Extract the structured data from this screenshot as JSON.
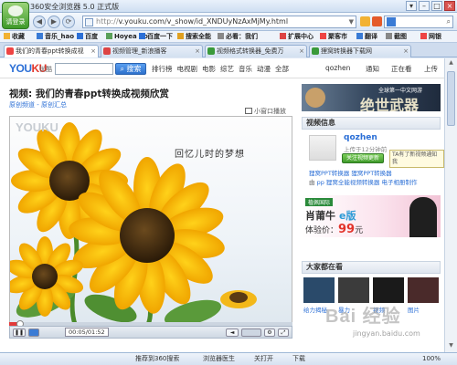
{
  "window": {
    "title": "360安全浏览器 5.0 正式版",
    "logo_label": "请登录",
    "controls": [
      "▾",
      "–",
      "□",
      "×"
    ]
  },
  "nav": {
    "url_prefix": "http://",
    "url": "v.youku.com/v_show/id_XNDUyNzAxMjMy.html",
    "search_placeholder": "",
    "buttons": [
      "◀",
      "▶",
      "⟳",
      "⌂"
    ]
  },
  "favorites": {
    "items": [
      "收藏",
      "音乐_hao",
      "百度",
      "Hoyea So",
      "百度一下",
      "搜索全能",
      "必看：我们",
      "扩展中心",
      "聚客市",
      "翻译",
      "截图",
      "网银"
    ]
  },
  "tabs": [
    {
      "label": "我们的青春ppt转换成视",
      "active": true
    },
    {
      "label": "视频管理_新浪播客",
      "active": false
    },
    {
      "label": "视频格式转换器_免费万",
      "active": false
    },
    {
      "label": "狸窝转换器下载网",
      "active": false
    }
  ],
  "youku": {
    "logo_left": "YOU",
    "logo_right": "KU",
    "logo_sub": "优酷",
    "search_button": "搜索",
    "nav_items": [
      "排行榜",
      "电视剧",
      "电影",
      "综艺",
      "音乐",
      "动漫",
      "全部"
    ],
    "user_name": "qozhen",
    "notice_label": "通知",
    "watching_label": "正在看",
    "upload_label": "上传"
  },
  "video": {
    "title": "视频: 我们的青春ppt转换成视频欣赏",
    "crumbs": "原创频道 - 原创汇总",
    "small_window": "小窗口播放",
    "watermark": "YOUKU",
    "caption": "回忆儿时的梦想",
    "time": "00:05/01:52",
    "progress_fraction": 0.04
  },
  "sidebar": {
    "banner1_text": "绝世武器",
    "banner1_sub": "全球第一中文网游",
    "info_header": "视频信息",
    "uploader": "qozhen",
    "uploaded_ago": "上传于12分钟前",
    "follow_label": "关注视频更新",
    "tooltip": "TA有了新视频通知我",
    "software_line1": "狸窝PPT转换器 狸窝PPT转换器",
    "software_line2": "狸窝全能视频转换器 电子相册制作",
    "software_prefix": "由",
    "software_link": "pp",
    "banner2_title": "肖莆牛",
    "banner2_brand": "e版",
    "banner2_brand_prefix": "体验价：",
    "banner2_price": "99",
    "banner2_unit": "元",
    "banner2_badge": "植佩国际",
    "recommend_header": "大家都在看",
    "recommend_items": [
      {
        "title": "给力揭秘",
        "color": "#2a4a6a"
      },
      {
        "title": "暴力",
        "color": "#3b3b3b"
      },
      {
        "title": "视频",
        "color": "#1a1a1a"
      },
      {
        "title": "图片",
        "color": "#4a2a2a"
      }
    ]
  },
  "status": {
    "items": [
      "推荐到360搜索",
      "浏览器医生",
      "关打开",
      "下载"
    ],
    "zoom": "100%"
  },
  "watermark": {
    "text": "Bai 经验",
    "url": "jingyan.baidu.com"
  }
}
